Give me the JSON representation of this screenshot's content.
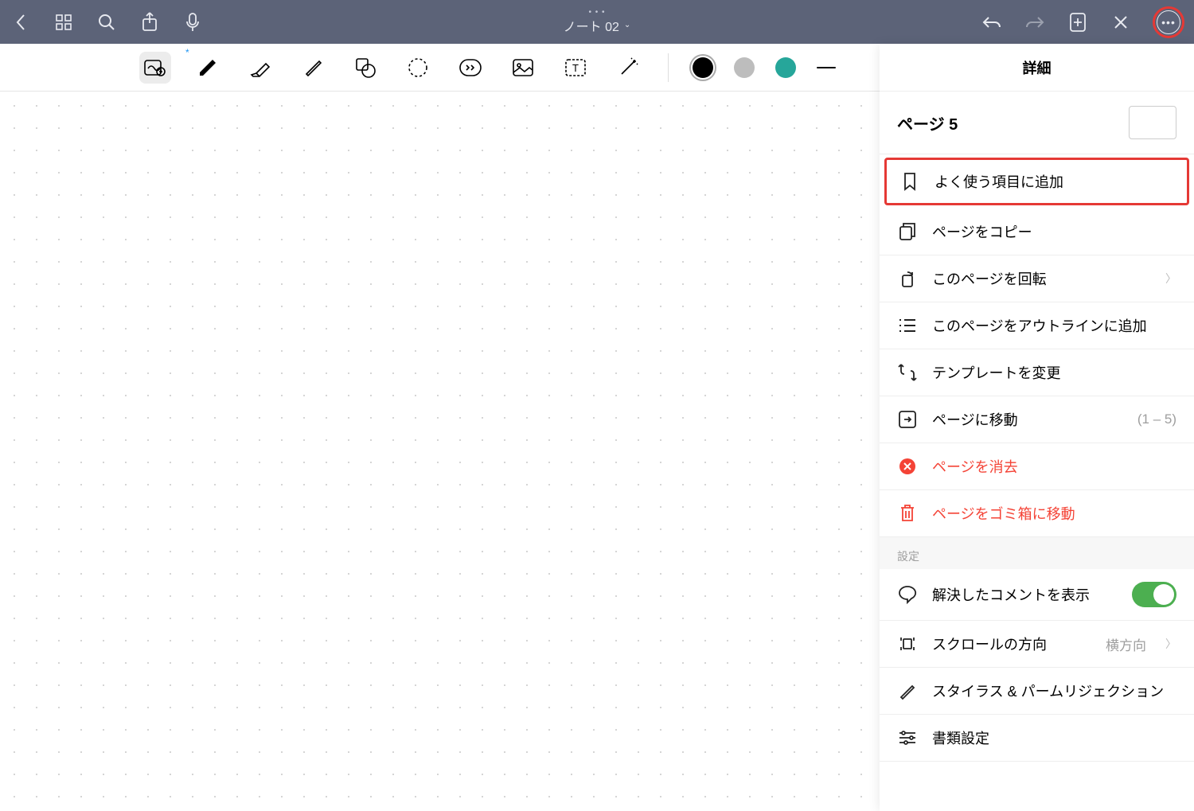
{
  "titlebar": {
    "title": "ノート 02"
  },
  "panel": {
    "header": "詳細",
    "page_label": "ページ 5",
    "items": {
      "favorite": "よく使う項目に追加",
      "copy": "ページをコピー",
      "rotate": "このページを回転",
      "outline": "このページをアウトラインに追加",
      "template": "テンプレートを変更",
      "goto": "ページに移動",
      "goto_range": "(1 – 5)",
      "clear": "ページを消去",
      "trash": "ページをゴミ箱に移動"
    },
    "settings_label": "設定",
    "settings": {
      "comments": "解決したコメントを表示",
      "scroll": "スクロールの方向",
      "scroll_value": "横方向",
      "stylus": "スタイラス & パームリジェクション",
      "doc": "書類設定"
    }
  }
}
